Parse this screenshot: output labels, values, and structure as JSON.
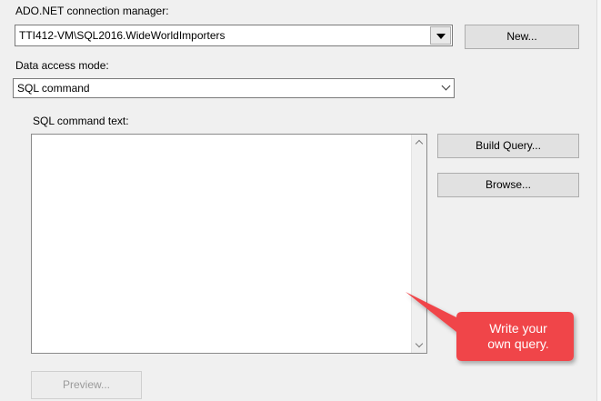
{
  "connection_manager": {
    "label": "ADO.NET connection manager:",
    "value": "TTI412-VM\\SQL2016.WideWorldImporters",
    "new_button": "New..."
  },
  "data_access_mode": {
    "label": "Data access mode:",
    "value": "SQL command"
  },
  "sql_command": {
    "label": "SQL command text:",
    "text": "",
    "build_query_button": "Build Query...",
    "browse_button": "Browse..."
  },
  "preview_button": "Preview...",
  "callout": {
    "line1": "Write your",
    "line2": "own query.",
    "color": "#f0444a"
  }
}
